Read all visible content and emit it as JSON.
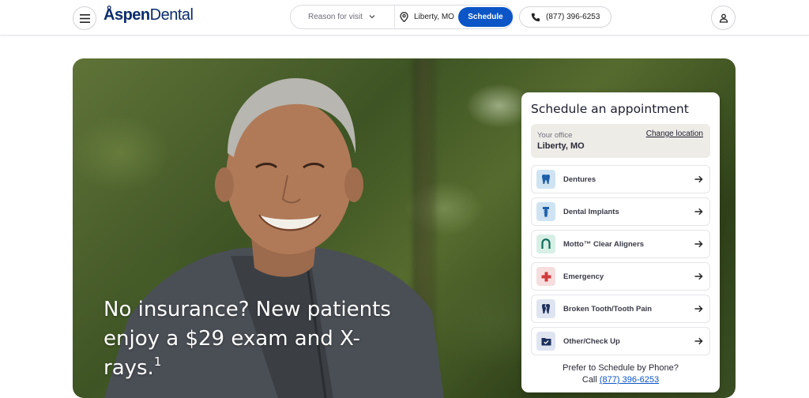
{
  "header": {
    "logo_part1": "Åspen",
    "logo_part2": "Dental",
    "reason_placeholder": "Reason for visit",
    "location": "Liberty, MO",
    "schedule_label": "Schedule",
    "phone": "(877) 396-6253"
  },
  "hero": {
    "headline": "No insurance? New patients enjoy a $29 exam and X-rays.",
    "footnote": "1"
  },
  "card": {
    "title": "Schedule an appointment",
    "office_label": "Your office",
    "office_name": "Liberty, MO",
    "change_location": "Change location",
    "services": [
      {
        "label": "Dentures",
        "icon": "tooth-icon",
        "color": "#cfe3f3"
      },
      {
        "label": "Dental Implants",
        "icon": "implant-icon",
        "color": "#cfe3f3"
      },
      {
        "label": "Motto™ Clear Aligners",
        "icon": "aligner-icon",
        "color": "#d8efe6"
      },
      {
        "label": "Emergency",
        "icon": "emergency-cross-icon",
        "color": "#f6dede"
      },
      {
        "label": "Broken Tooth/Tooth Pain",
        "icon": "broken-tooth-icon",
        "color": "#dfe4f1"
      },
      {
        "label": "Other/Check Up",
        "icon": "checkup-icon",
        "color": "#dfe4f1"
      }
    ],
    "prefer_phone": "Prefer to Schedule by Phone?",
    "call_label": "Call",
    "call_number": "(877) 396-6253"
  },
  "colors": {
    "brand_blue": "#0b55c6",
    "logo_navy": "#0b2c6b"
  }
}
